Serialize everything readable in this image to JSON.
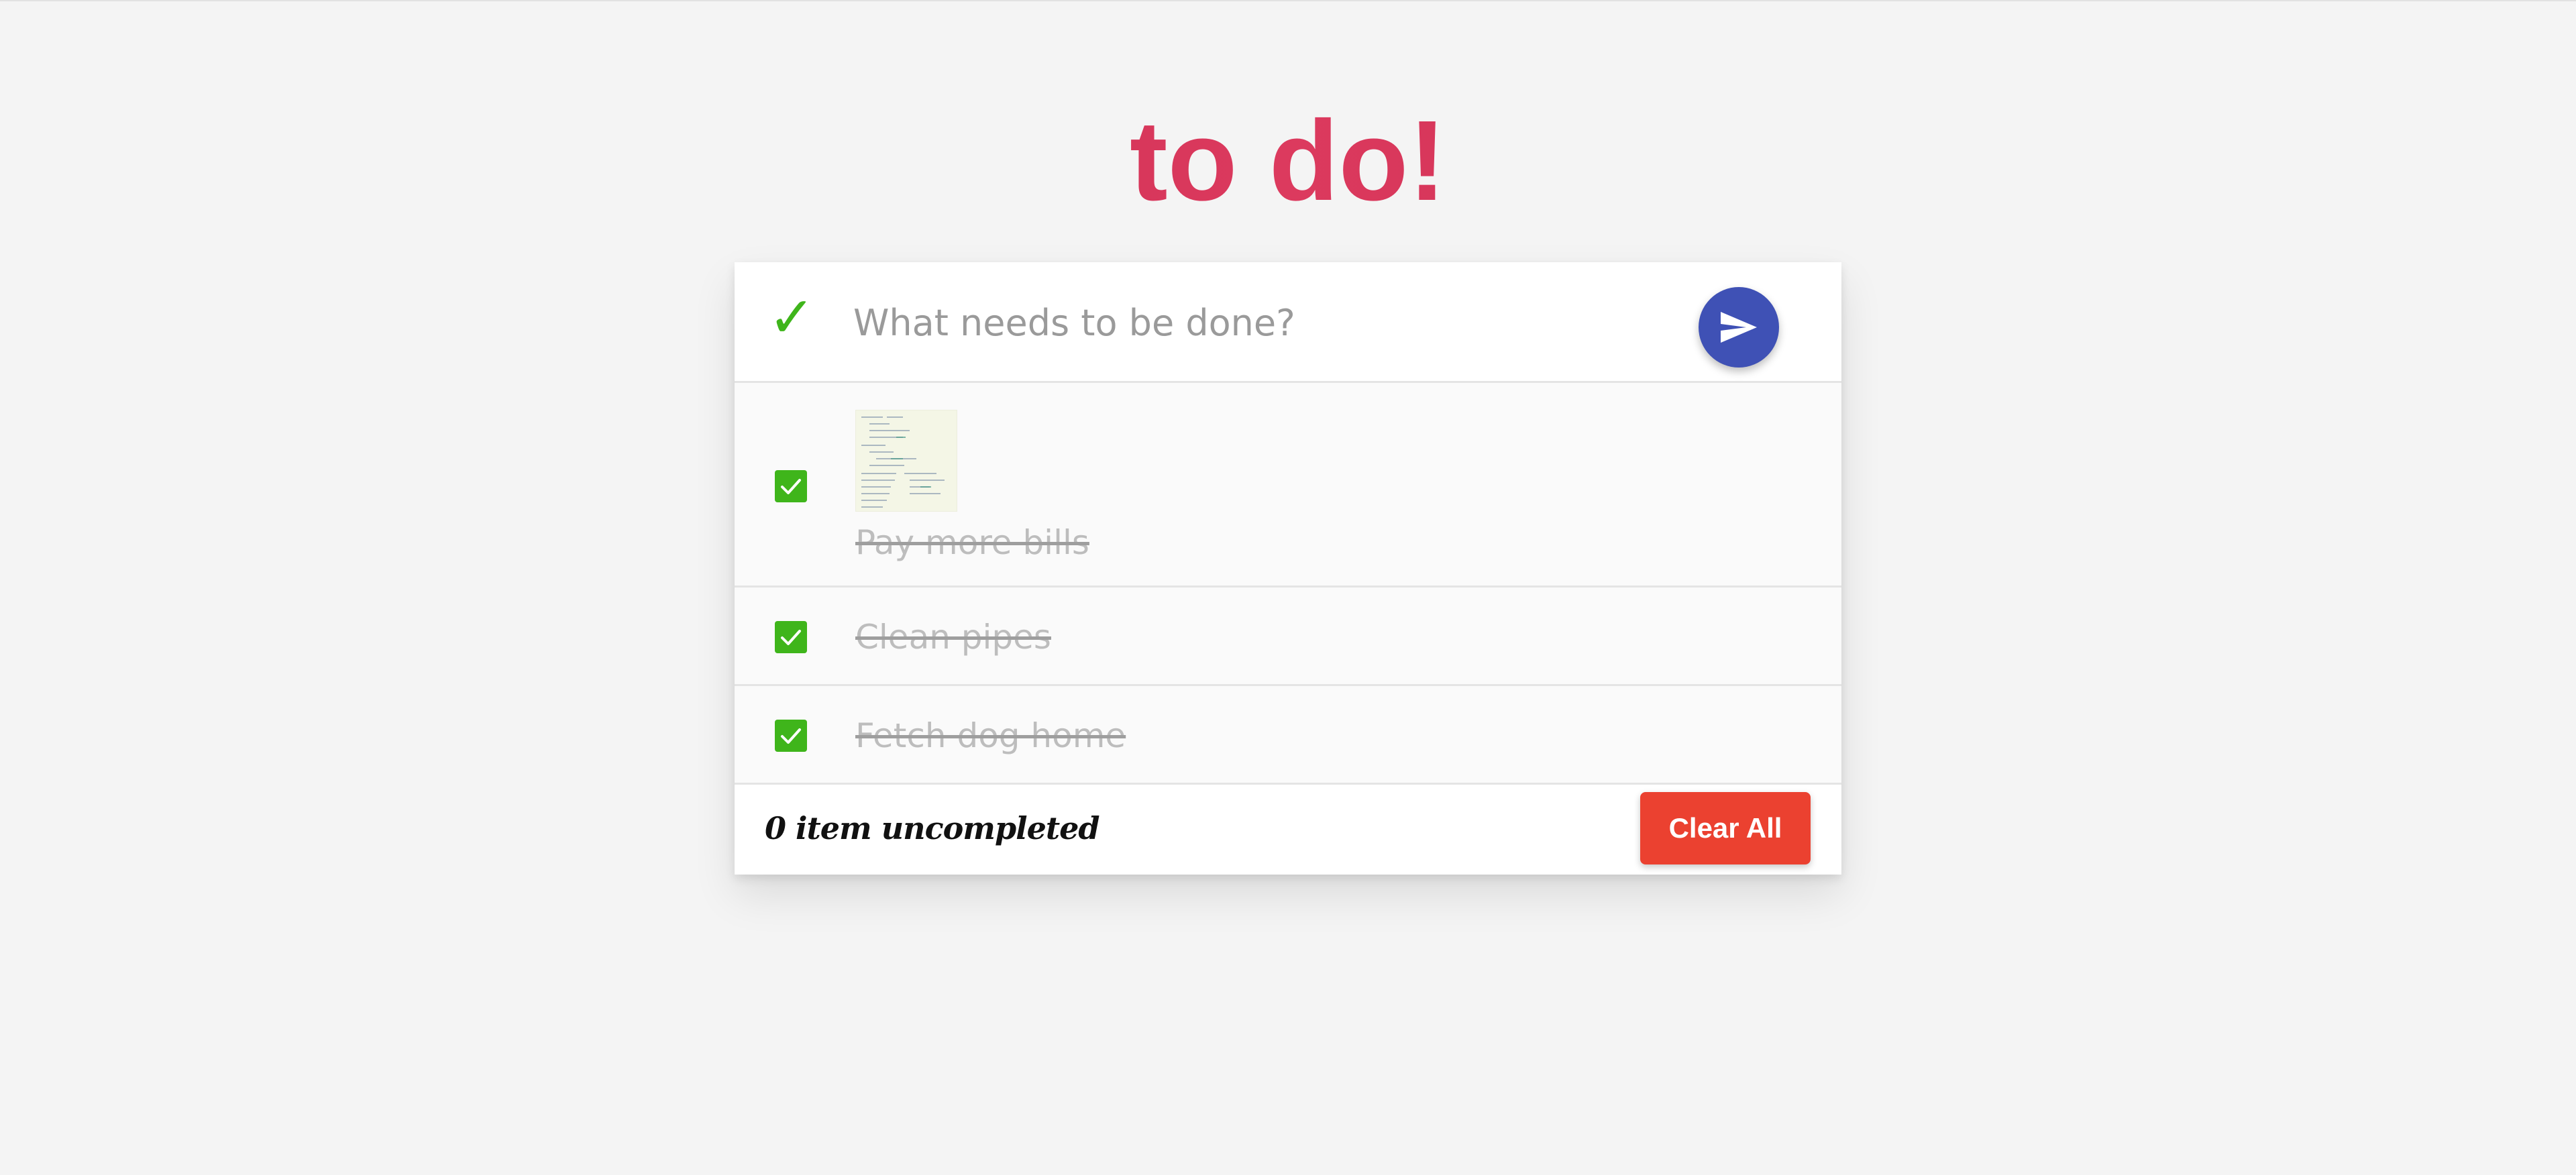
{
  "app": {
    "title": "to do!",
    "accent_color": "#c8284e"
  },
  "input": {
    "placeholder": "What needs to be done?",
    "value": "",
    "leading_icon": "checkmark-icon",
    "submit_icon": "send-icon",
    "submit_color": "#3f51b5"
  },
  "todos": [
    {
      "label": "Pay more bills",
      "completed": true,
      "has_attachment": true,
      "attachment_icon": "image-thumbnail"
    },
    {
      "label": "Clean pipes",
      "completed": true
    },
    {
      "label": "Fetch dog home",
      "completed": true
    }
  ],
  "footer": {
    "count_text": "0 item uncompleted",
    "clear_label": "Clear All",
    "clear_color": "#eb4130"
  },
  "colors": {
    "check_green": "#3fb51b",
    "background": "#f4f4f4"
  }
}
